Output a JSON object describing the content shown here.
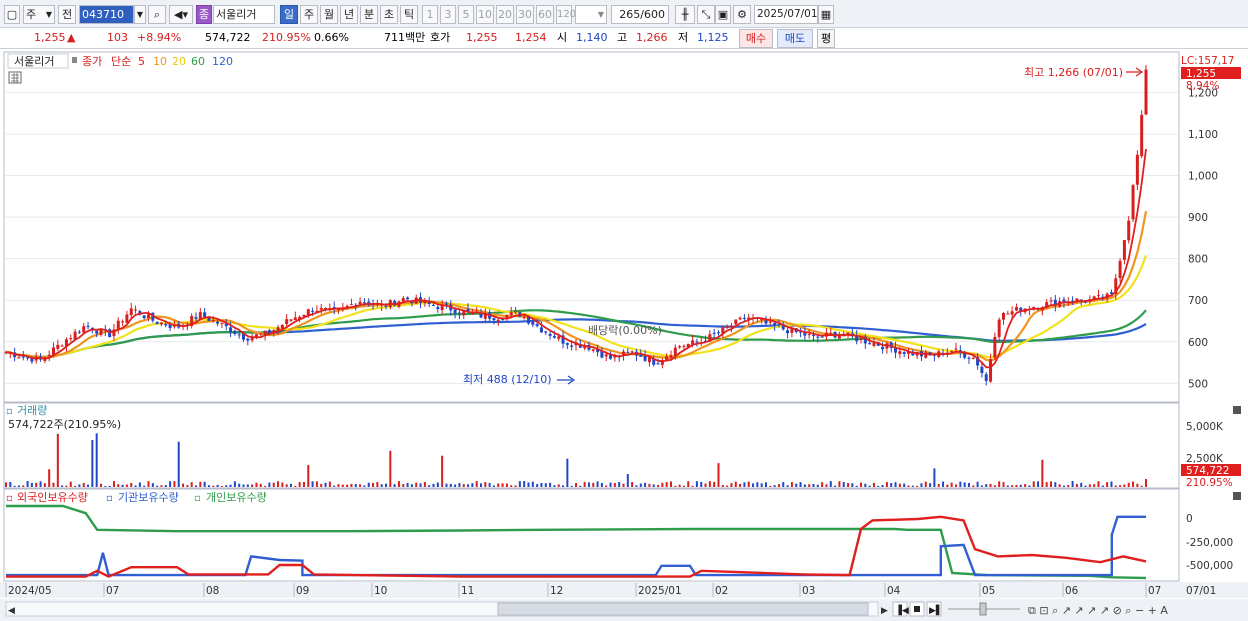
{
  "toolbar": {
    "type_select": "주",
    "prev_label": "전",
    "stock_code": "043710",
    "stock_name": "서울리거",
    "stock_badge": "종",
    "periods": [
      "일",
      "주",
      "월",
      "년",
      "분",
      "초",
      "틱"
    ],
    "selected_period": "일",
    "intervals": [
      "1",
      "3",
      "5",
      "10",
      "20",
      "30",
      "60",
      "120"
    ],
    "count_display": "265",
    "count_max": "/600",
    "date": "2025/07/01"
  },
  "quote": {
    "price": "1,255",
    "change_arrow": "▲",
    "change": "103",
    "change_pct": "+8.94%",
    "volume": "574,722",
    "volume_ratio": "210.95%",
    "turnover": "0.66%",
    "amount": "711백만",
    "ask_label": "호가",
    "ask": "1,255",
    "bid": "1,254",
    "open_label": "시",
    "open": "1,140",
    "high_label": "고",
    "high": "1,266",
    "low_label": "저",
    "low": "1,125",
    "buy_button": "매수",
    "sell_button": "매도",
    "avg_button": "평"
  },
  "legend": {
    "name": "서울리거",
    "close_label": "종가",
    "ma_type": "단순",
    "ma": [
      {
        "label": "5",
        "color": "#e01f1f"
      },
      {
        "label": "10",
        "color": "#f0961e"
      },
      {
        "label": "20",
        "color": "#f2e21c"
      },
      {
        "label": "60",
        "color": "#2e9c4a"
      },
      {
        "label": "120",
        "color": "#2f5fd0"
      }
    ]
  },
  "annotations": {
    "high": "최고 1,266 (07/01)",
    "low": "최저 488 (12/10)",
    "dividend": "배당락(0.00%)",
    "lc": "LC:157,17",
    "price_tag": "1,255",
    "pct_tag": "8,94%"
  },
  "price_axis": [
    "1,200",
    "1,100",
    "1,000",
    "900",
    "800",
    "700",
    "600",
    "500"
  ],
  "volume_panel": {
    "title": "거래량",
    "value": "574,722주(210.95%)",
    "axis": [
      "5,000K",
      "2,500K"
    ],
    "tag": "574,722",
    "pct_tag": "210.95%"
  },
  "holdings_panel": {
    "series": [
      {
        "label": "외국인보유수량",
        "color": "#e01f1f"
      },
      {
        "label": "기관보유수량",
        "color": "#2f5fd0"
      },
      {
        "label": "개인보유수량",
        "color": "#2e9c4a"
      }
    ],
    "axis": [
      "0",
      "-250,000",
      "-500,000"
    ]
  },
  "x_axis": [
    "2024/05",
    "07",
    "08",
    "09",
    "10",
    "11",
    "12",
    "2025/01",
    "02",
    "03",
    "04",
    "05",
    "06",
    "07"
  ],
  "x_axis_right": "07/01",
  "chart_data": {
    "type": "candlestick",
    "ylim": [
      460,
      1290
    ],
    "y_ticks": [
      500,
      600,
      700,
      800,
      900,
      1000,
      1100,
      1200
    ],
    "close_path": [
      [
        0,
        575
      ],
      [
        0.03,
        555
      ],
      [
        0.05,
        600
      ],
      [
        0.07,
        640
      ],
      [
        0.09,
        615
      ],
      [
        0.11,
        680
      ],
      [
        0.13,
        650
      ],
      [
        0.15,
        635
      ],
      [
        0.17,
        665
      ],
      [
        0.19,
        640
      ],
      [
        0.21,
        610
      ],
      [
        0.23,
        620
      ],
      [
        0.25,
        655
      ],
      [
        0.27,
        680
      ],
      [
        0.29,
        670
      ],
      [
        0.31,
        700
      ],
      [
        0.33,
        685
      ],
      [
        0.35,
        705
      ],
      [
        0.37,
        690
      ],
      [
        0.39,
        680
      ],
      [
        0.41,
        665
      ],
      [
        0.43,
        660
      ],
      [
        0.45,
        668
      ],
      [
        0.47,
        630
      ],
      [
        0.49,
        600
      ],
      [
        0.51,
        590
      ],
      [
        0.53,
        560
      ],
      [
        0.55,
        575
      ],
      [
        0.57,
        550
      ],
      [
        0.59,
        590
      ],
      [
        0.61,
        600
      ],
      [
        0.63,
        630
      ],
      [
        0.65,
        660
      ],
      [
        0.67,
        640
      ],
      [
        0.69,
        625
      ],
      [
        0.71,
        610
      ],
      [
        0.73,
        620
      ],
      [
        0.75,
        605
      ],
      [
        0.77,
        590
      ],
      [
        0.79,
        575
      ],
      [
        0.81,
        565
      ],
      [
        0.83,
        580
      ],
      [
        0.85,
        560
      ],
      [
        0.86,
        505
      ],
      [
        0.87,
        660
      ],
      [
        0.89,
        680
      ],
      [
        0.91,
        690
      ],
      [
        0.93,
        700
      ],
      [
        0.95,
        700
      ],
      [
        0.97,
        710
      ],
      [
        0.985,
        900
      ],
      [
        0.995,
        1100
      ],
      [
        1,
        1255
      ]
    ],
    "high": {
      "value": 1266,
      "date": "07/01"
    },
    "low": {
      "value": 488,
      "date": "12/10"
    },
    "last": 1255
  }
}
